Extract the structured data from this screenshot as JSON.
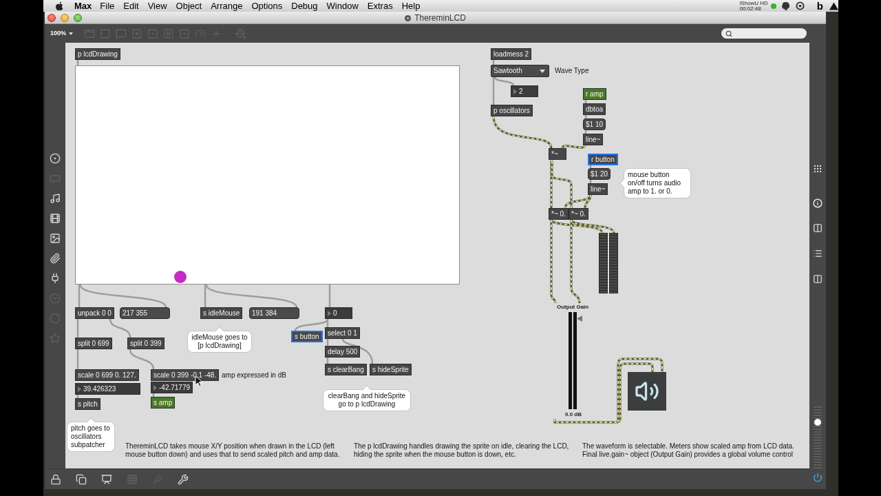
{
  "menu_bar": {
    "app": "Max",
    "items": [
      "File",
      "Edit",
      "View",
      "Object",
      "Arrange",
      "Options",
      "Debug",
      "Window",
      "Extras",
      "Help"
    ],
    "recorder": {
      "name": "iShowU HD",
      "time": "00:02:48"
    },
    "status_glyph": "b"
  },
  "window": {
    "title": "ThereminLCD"
  },
  "toolbar": {
    "zoom": "100%",
    "tools": [
      {
        "disabled": true
      },
      {
        "disabled": true
      },
      {
        "disabled": true
      },
      {
        "disabled": true
      },
      {
        "disabled": true
      },
      {
        "disabled": true
      },
      {
        "disabled": true
      },
      {
        "disabled": true
      },
      {
        "disabled": true
      },
      {
        "disabled": true
      }
    ]
  },
  "left_sidebar": {
    "tools": [
      {
        "disabled": false
      },
      {
        "disabled": true
      },
      {
        "disabled": false
      },
      {
        "disabled": false
      },
      {
        "disabled": false
      },
      {
        "disabled": false
      },
      {
        "disabled": false
      },
      {
        "disabled": true
      },
      {
        "disabled": true
      },
      {
        "disabled": true
      }
    ]
  },
  "patch": {
    "objects": [
      {
        "kind": "object",
        "text": "p lcdDrawing",
        "color": "#474747",
        "selected": false
      },
      {
        "kind": "object",
        "text": "unpack 0 0",
        "color": "#474747",
        "selected": false
      },
      {
        "kind": "message",
        "text": "217 355",
        "color": "#4a4a4a",
        "selected": false
      },
      {
        "kind": "object",
        "text": "s idleMouse",
        "color": "#474747",
        "selected": false
      },
      {
        "kind": "message",
        "text": "191 384",
        "color": "#4a4a4a",
        "selected": false
      },
      {
        "kind": "number",
        "text": "0",
        "color": "#3b3b3b",
        "selected": false
      },
      {
        "kind": "object",
        "text": "select 0 1",
        "color": "#474747",
        "selected": false
      },
      {
        "kind": "object",
        "text": "s button",
        "color": "#474747",
        "selected": true
      },
      {
        "kind": "object",
        "text": "split 0 699",
        "color": "#474747",
        "selected": false
      },
      {
        "kind": "object",
        "text": "split 0 399",
        "color": "#474747",
        "selected": false
      },
      {
        "kind": "object",
        "text": "delay 500",
        "color": "#474747",
        "selected": false
      },
      {
        "kind": "object",
        "text": "s clearBang",
        "color": "#474747",
        "selected": false
      },
      {
        "kind": "object",
        "text": "s hideSprite",
        "color": "#474747",
        "selected": false
      },
      {
        "kind": "object",
        "text": "scale 0 699 0. 127.",
        "color": "#474747",
        "selected": false
      },
      {
        "kind": "object",
        "text": "scale 0 399 -0.1 -48.",
        "color": "#474747",
        "selected": false
      },
      {
        "kind": "number",
        "text": "39.426323",
        "color": "#3b3b3b",
        "selected": false
      },
      {
        "kind": "number",
        "text": "-42.71779",
        "color": "#3b3b3b",
        "selected": false
      },
      {
        "kind": "object",
        "text": "s pitch",
        "color": "#474747",
        "selected": false
      },
      {
        "kind": "object",
        "text": "s amp",
        "color": "#4a7a25",
        "selected": false
      },
      {
        "kind": "object",
        "text": "loadmess 2",
        "color": "#474747",
        "selected": false
      },
      {
        "kind": "menu",
        "text": "Sawtooth",
        "color": "#4a4a4a",
        "selected": false
      },
      {
        "kind": "number",
        "text": "2",
        "color": "#3b3b3b",
        "selected": false
      },
      {
        "kind": "object",
        "text": "p oscillators",
        "color": "#474747",
        "selected": false
      },
      {
        "kind": "object",
        "text": "r amp",
        "color": "#4a7a25",
        "selected": false
      },
      {
        "kind": "object",
        "text": "dbtoa",
        "color": "#474747",
        "selected": false
      },
      {
        "kind": "message",
        "text": "$1 10",
        "color": "#4a4a4a",
        "selected": false
      },
      {
        "kind": "object",
        "text": "line~",
        "color": "#474747",
        "selected": false
      },
      {
        "kind": "object",
        "text": "*~",
        "color": "#474747",
        "selected": false
      },
      {
        "kind": "object",
        "text": "r button",
        "color": "#474747",
        "selected": true
      },
      {
        "kind": "message",
        "text": "$1 20",
        "color": "#4a4a4a",
        "selected": false
      },
      {
        "kind": "object",
        "text": "line~",
        "color": "#474747",
        "selected": false
      },
      {
        "kind": "object",
        "text": "*~ 0.",
        "color": "#474747",
        "selected": false
      },
      {
        "kind": "object",
        "text": "*~ 0.",
        "color": "#474747",
        "selected": false
      }
    ],
    "comments": [
      "Wave Type",
      "amp expressed in dB",
      "ThereminLCD takes mouse X/Y position when drawn in the LCD (left mouse button down) and uses that to send scaled pitch and amp data.",
      "The p lcdDrawing handles drawing the sprite on idle, clearing the LCD, hiding the sprite when the mouse button is down, etc.",
      "The waveform is selectable. Meters show scaled amp from LCD data. Final live.gain~ object (Output Gain) provides a global volume control"
    ],
    "bubbles": [
      "idleMouse goes to [p lcdDrawing]",
      "clearBang and hideSprite go to p lcdDrawing",
      "pitch goes to oscillators subpatcher",
      "mouse button on/off turns audio amp to 1. or 0."
    ],
    "gain": {
      "label": "Output Gain",
      "reading": "0.0 dB",
      "level": 0.96
    }
  },
  "right_sidebar": {
    "volume": {
      "level": 0.78
    }
  },
  "bottom_bar": {
    "tools": [
      {
        "disabled": false
      },
      {
        "disabled": false
      },
      {
        "disabled": false
      },
      {
        "disabled": true
      },
      {
        "disabled": true
      },
      {
        "disabled": false
      }
    ]
  }
}
